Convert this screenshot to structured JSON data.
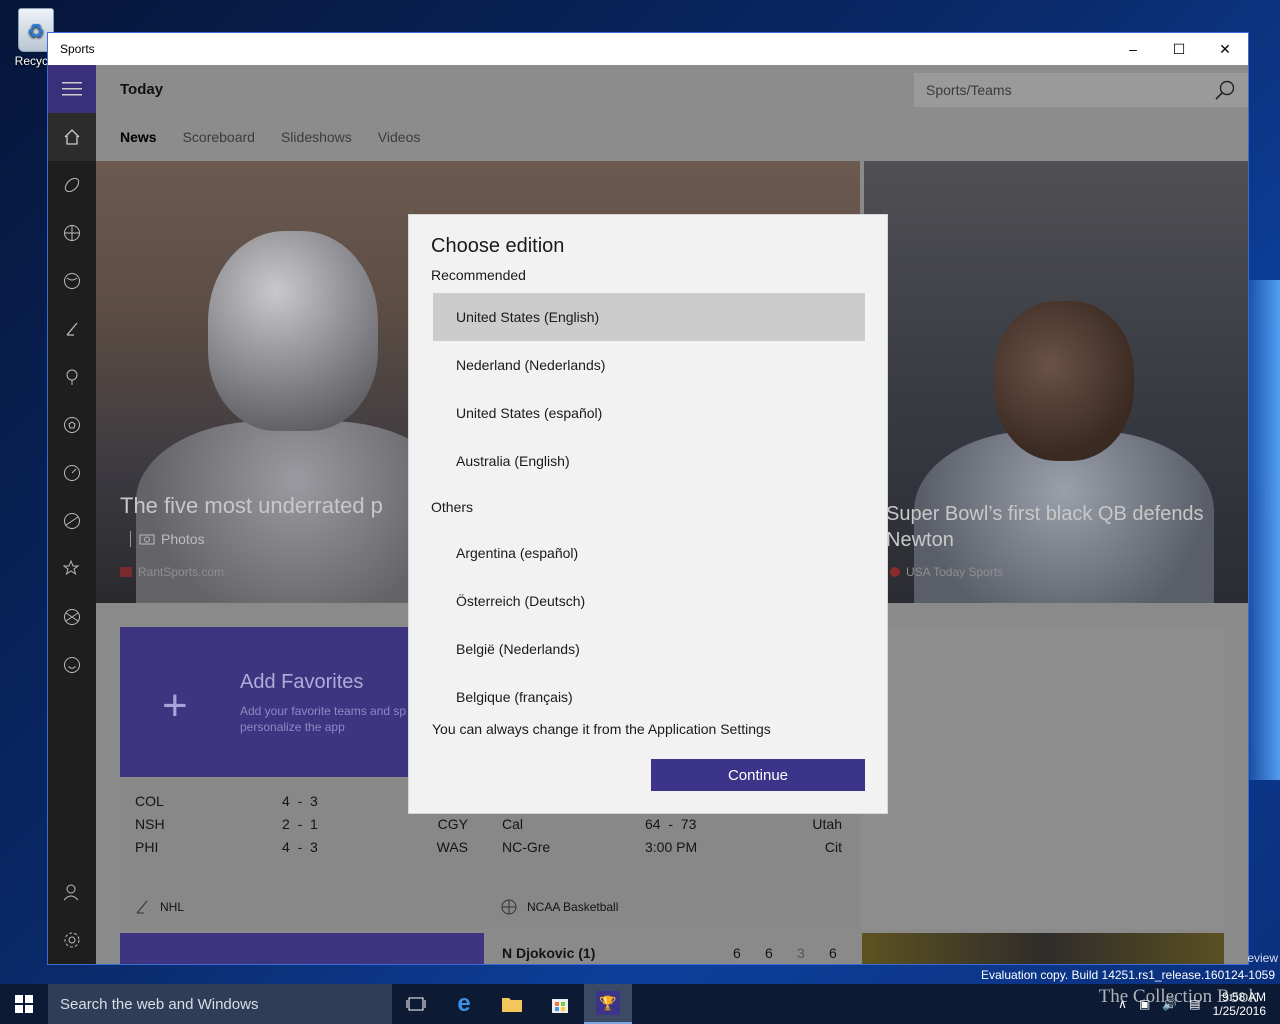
{
  "desktop": {
    "recycle_label": "Recycle"
  },
  "window": {
    "title": "Sports"
  },
  "header": {
    "title": "Today",
    "search_placeholder": "Sports/Teams"
  },
  "tabs": [
    "News",
    "Scoreboard",
    "Slideshows",
    "Videos"
  ],
  "hero_left": {
    "headline": "The five most underrated p",
    "type": "Photos",
    "source": "RantSports.com"
  },
  "hero_right": {
    "headline": "Super Bowl’s first black QB defends Newton",
    "source": "USA Today Sports"
  },
  "favorites": {
    "title": "Add Favorites",
    "subtitle": "Add your favorite teams and sp personalize the app"
  },
  "nhl": {
    "rows": [
      {
        "home": "COL",
        "score": "4  -  3",
        "away": ""
      },
      {
        "home": "NSH",
        "score": "2  -  1",
        "away": "CGY"
      },
      {
        "home": "PHI",
        "score": "4  -  3",
        "away": "WAS"
      }
    ],
    "league": "NHL"
  },
  "ncaa": {
    "rows": [
      {
        "home": "Cal",
        "score": "64  -  73",
        "away": "Utah"
      },
      {
        "home": "NC-Gre",
        "score": "3:00 PM",
        "away": "Cit"
      }
    ],
    "league": "NCAA Basketball"
  },
  "tennis": {
    "player": "N Djokovic (1)",
    "sets": [
      "6",
      "6",
      "3",
      "6"
    ]
  },
  "dialog": {
    "title": "Choose edition",
    "recommended_label": "Recommended",
    "recommended": [
      "United States (English)",
      "Nederland (Nederlands)",
      "United States (español)",
      "Australia (English)"
    ],
    "others_label": "Others",
    "others": [
      "Argentina (español)",
      "Österreich (Deutsch)",
      "België (Nederlands)",
      "Belgique (français)"
    ],
    "note": "You can always change it from the Application Settings",
    "continue_label": "Continue"
  },
  "taskbar": {
    "search_placeholder": "Search the web and Windows",
    "build": "Evaluation copy. Build 14251.rs1_release.160124-1059",
    "edge_text": "eview",
    "time": "9:58 AM",
    "date": "1/25/2016",
    "watermark": "The Collection Book"
  }
}
